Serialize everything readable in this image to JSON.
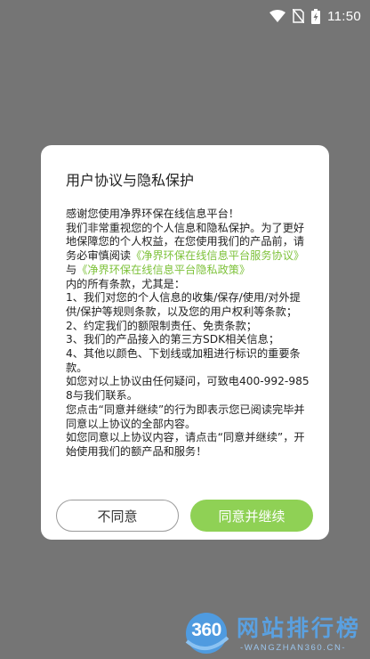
{
  "status_bar": {
    "time": "11:50"
  },
  "dialog": {
    "title": "用户协议与隐私保护",
    "intro_greeting": "感谢您使用净界环保在线信息平台！",
    "intro_text": "我们非常重视您的个人信息和隐私保护。为了更好地保障您的个人权益，在您使用我们的产品前，请务必审慎阅读",
    "link_service_agreement": "《净界环保在线信息平台服务协议》",
    "and_text": "与",
    "link_privacy_policy": "《净界环保在线信息平台隐私政策》",
    "terms_intro": "内的所有条款，尤其是：",
    "items": [
      "1、我们对您的个人信息的收集/保存/使用/对外提供/保护等规则条款，以及您的用户权利等条款；",
      "2、约定我们的额限制责任、免责条款；",
      "3、我们的产品接入的第三方SDK相关信息；",
      "4、其他以颜色、下划线或加粗进行标识的重要条款。"
    ],
    "contact_text": "如您对以上协议由任何疑问，可致电400-992-9858与我们联系。",
    "notice_text": "您点击“同意并继续”的行为即表示您已阅读完毕并同意以上协议的全部内容。",
    "final_text": "如您同意以上协议内容，请点击“同意并继续”，开始使用我们的额产品和服务！",
    "decline_label": "不同意",
    "accept_label": "同意并继续"
  },
  "watermark": {
    "logo_text": "360",
    "title": "网站排行榜",
    "url": "-WANGZHAN360.CN-"
  },
  "colors": {
    "overlay": "#757575",
    "link": "#7ec23b",
    "accept_button": "#8fd155",
    "watermark_blue": "#5aa0e0"
  },
  "icons": [
    "wifi-icon",
    "no-sim-icon",
    "battery-charging-icon"
  ]
}
